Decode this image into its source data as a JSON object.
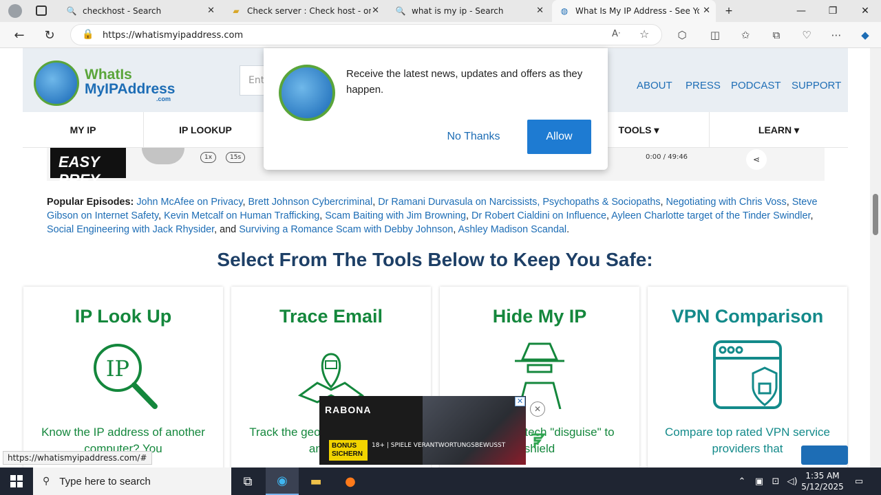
{
  "browser": {
    "tabs": [
      {
        "label": "checkhost - Search",
        "icon": "search-icon"
      },
      {
        "label": "Check server : Check host - onlin",
        "icon": "folder-icon"
      },
      {
        "label": "what is my ip - Search",
        "icon": "search-icon"
      },
      {
        "label": "What Is My IP Address - See Your",
        "icon": "globe-icon"
      }
    ],
    "url": "https://whatismyipaddress.com"
  },
  "site": {
    "logo": {
      "line1": "WhatIs",
      "line2": "MyIPAddress",
      "line3": ".com"
    },
    "search_placeholder": "Ent",
    "top_links": [
      "ABOUT",
      "PRESS",
      "PODCAST",
      "SUPPORT"
    ],
    "nav": [
      "MY IP",
      "IP LOOKUP",
      "TOOLS ▾",
      "LEARN ▾"
    ]
  },
  "player": {
    "podcast_title": "EASY PREY",
    "speed": "1x",
    "rewind": "15s",
    "time_current": "0:00",
    "time_sep": "/",
    "time_total": "49:46"
  },
  "episodes": {
    "label": "Popular Episodes:",
    "items": [
      "John McAfee on Privacy",
      "Brett Johnson Cybercriminal",
      "Dr Ramani Durvasula on Narcissists, Psychopaths & Sociopaths",
      "Negotiating with Chris Voss",
      "Steve Gibson on Internet Safety",
      "Kevin Metcalf on Human Trafficking",
      "Scam Baiting with Jim Browning",
      "Dr Robert Cialdini on Influence",
      "Ayleen Charlotte target of the Tinder Swindler",
      "Social Engineering with Jack Rhysider",
      "Surviving a Romance Scam with Debby Johnson",
      "Ashley Madison Scandal"
    ],
    "and_text": "and"
  },
  "tools": {
    "heading": "Select From The Tools Below to Keep You Safe:",
    "cards": [
      {
        "title": "IP Look Up",
        "desc": "Know the IP address of another computer? You"
      },
      {
        "title": "Trace Email",
        "desc": "Track the geographical origin of an email"
      },
      {
        "title": "Hide My IP",
        "desc": "Use a high-tech \"disguise\" to shield"
      },
      {
        "title": "VPN Comparison",
        "desc": "Compare top rated VPN service providers that"
      }
    ]
  },
  "popup": {
    "message": "Receive the latest news, updates and offers as they happen.",
    "no_label": "No Thanks",
    "allow_label": "Allow"
  },
  "ad": {
    "brand": "RABONA",
    "badge": "BONUS SICHERN",
    "small_text": "18+ | SPIELE VERANTWORTUNGSBEWUSST"
  },
  "status_url": "https://whatismyipaddress.com/#",
  "taskbar": {
    "search_placeholder": "Type here to search",
    "time": "1:35 AM",
    "date": "5/12/2025"
  },
  "colors": {
    "link_blue": "#1d6db5",
    "tool_green": "#14873c",
    "tool_teal": "#138a8a",
    "heading_navy": "#1d3f66",
    "allow_blue": "#1e7bd2"
  }
}
